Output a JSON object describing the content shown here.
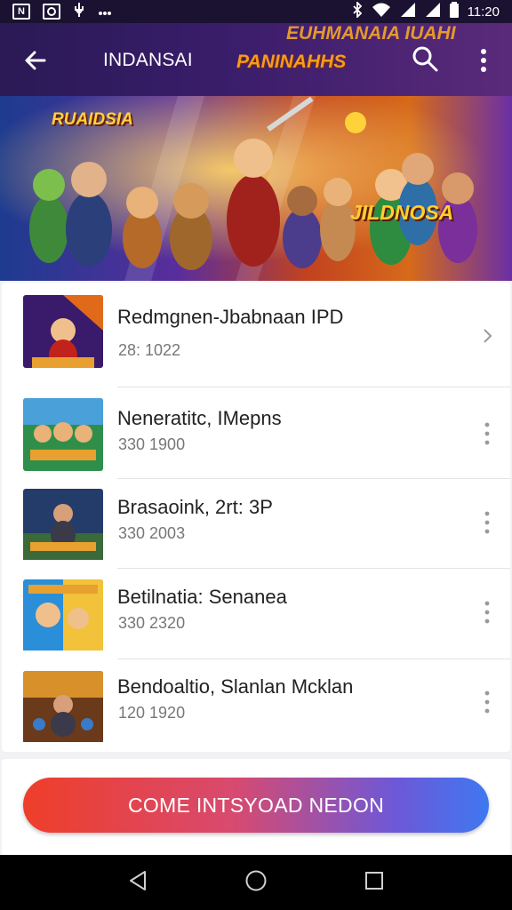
{
  "status_bar": {
    "left_icons": [
      "notification-n-icon",
      "app-icon",
      "usb-icon",
      "more-notifications-icon"
    ],
    "left_n": "N",
    "time": "11:20",
    "right_icons": [
      "bluetooth-icon",
      "wifi-icon",
      "signal-icon",
      "signal-icon-2",
      "battery-icon"
    ]
  },
  "app_bar": {
    "title": "INDANSAI",
    "brand_background_text": "EUHMANAIA IUAHI",
    "brand_logo_text": "PANINAHHS"
  },
  "banner": {
    "left_title": "RUAIDSIA",
    "right_title": "JILDNOSA"
  },
  "list": {
    "items": [
      {
        "title": "Redmgnen-Jbabnaan IPD",
        "meta": "28: 1022",
        "action": "chevron-right-icon"
      },
      {
        "title": "Neneratitc, IMepns",
        "meta": "330 1900",
        "action": "more-vert-icon"
      },
      {
        "title": "Brasaoink, 2rt: 3P",
        "meta": "330 2003",
        "action": "more-vert-icon"
      },
      {
        "title": "Betilnatia: Senanea",
        "meta": "330 2320",
        "action": "more-vert-icon"
      },
      {
        "title": "Bendoaltio, Slanlan Mcklan",
        "meta": "120 1920",
        "action": "more-vert-icon"
      }
    ]
  },
  "cta": {
    "label": "COME INTSYOAD NEDON"
  },
  "colors": {
    "app_bar_start": "#2a1a55",
    "app_bar_end": "#5a2a7a",
    "brand_orange": "#f79a1d",
    "cta_start": "#ef3e2a",
    "cta_end": "#3f78f0"
  }
}
